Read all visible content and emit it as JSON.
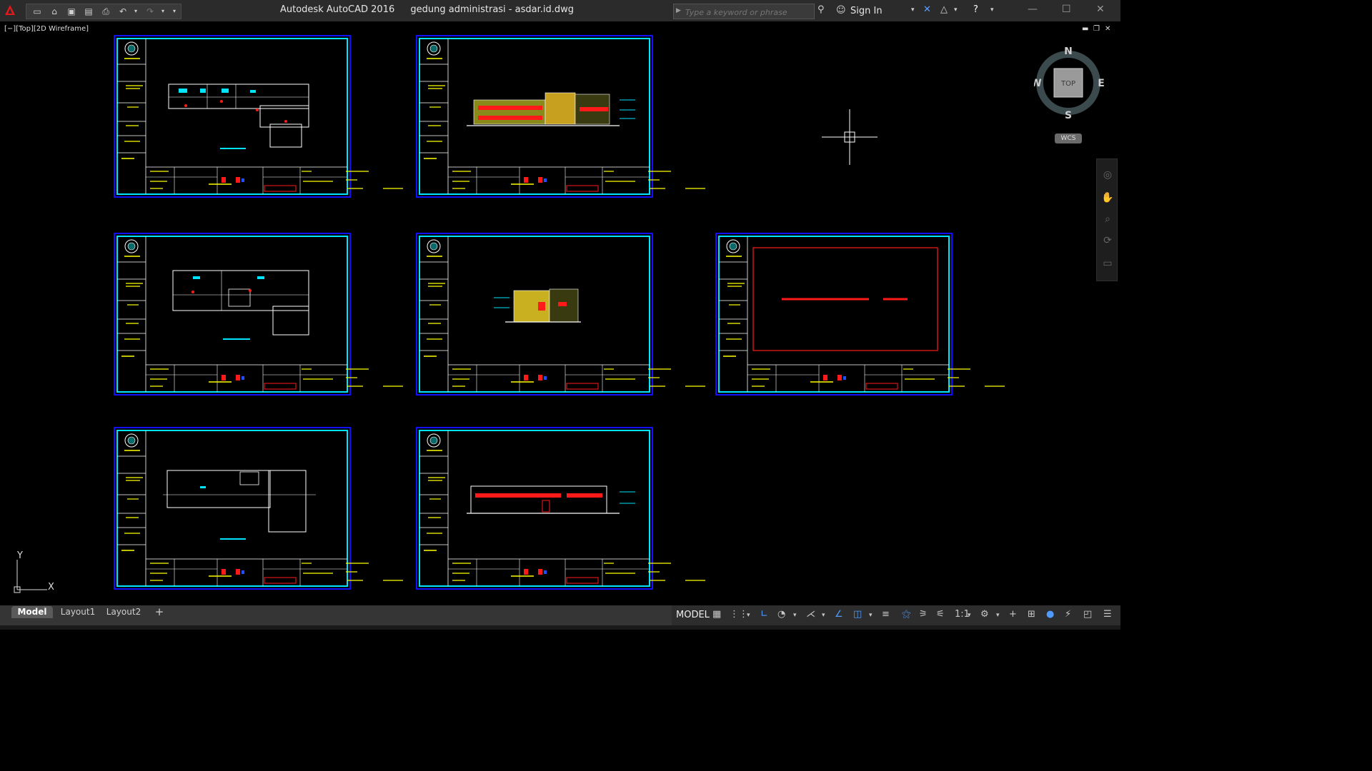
{
  "app": {
    "title": "Autodesk AutoCAD 2016",
    "document": "gedung administrasi - asdar.id.dwg"
  },
  "search": {
    "placeholder": "Type a keyword or phrase"
  },
  "account": {
    "signin_label": "Sign In"
  },
  "viewport": {
    "label": "[−][Top][2D Wireframe]"
  },
  "viewcube": {
    "north": "N",
    "south": "S",
    "east": "E",
    "west": "W",
    "face": "TOP",
    "wcs": "WCS"
  },
  "ucs": {
    "x": "X",
    "y": "Y"
  },
  "tabs": [
    "Model",
    "Layout1",
    "Layout2",
    "+"
  ],
  "status": {
    "model": "MODEL",
    "scale": "1:1"
  },
  "colors": {
    "sheet_outer": "#1010ff",
    "sheet_inner": "#00e5ff",
    "titleblock_text": "#ffff00",
    "drawing_red": "#ff1a1a",
    "drawing_white": "#ffffff",
    "drawing_cyan": "#00e5ff"
  }
}
